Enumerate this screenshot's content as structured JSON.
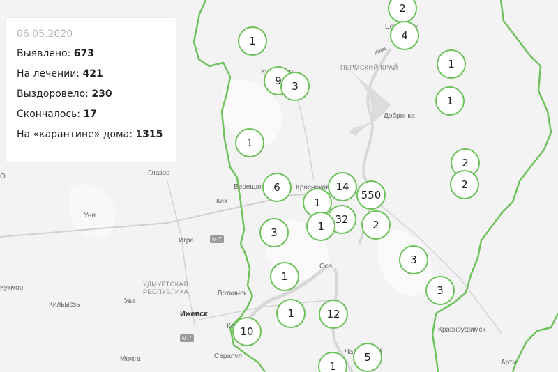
{
  "stats": {
    "date": "06.05.2020",
    "rows": [
      {
        "label": "Выявлено:",
        "value": "673"
      },
      {
        "label": "На лечении:",
        "value": "421"
      },
      {
        "label": "Выздоровело:",
        "value": "230"
      },
      {
        "label": "Скончалось:",
        "value": "17"
      },
      {
        "label": "На «карантине» дома:",
        "value": "1315"
      }
    ]
  },
  "regions": {
    "perm": "ПЕРМСКИЙ КРАЙ",
    "udmurt_line1": "УДМУРТСКАЯ",
    "udmurt_line2": "РЕСПУБЛИКА"
  },
  "places": {
    "glazov": "Глазов",
    "kez": "Кез",
    "uni": "Уни",
    "igra": "Игра",
    "votkinsk": "Воткинск",
    "izhevsk": "Ижевск",
    "kilmez": "Кильмезь",
    "uva": "Ува",
    "mozhga": "Можга",
    "sarapul": "Сарапул",
    "osa": "Оса",
    "dobryanka": "Добрянка",
    "vereshchagino": "Верещагино",
    "krasnokamsk": "Краснокамск",
    "krasnoufimsk": "Красноуфимск",
    "arti": "Арти",
    "kama": "Кама",
    "berezniki": "Березники",
    "chaykovsky": "Чайковский",
    "kudymkar": "Кудымкар",
    "kukmor": "Кукмор",
    "karakulino": "Ка",
    "bbr": "О"
  },
  "roads": {
    "m7_a": "M-7",
    "m7_b": "M-7"
  },
  "markers": [
    {
      "id": "a",
      "value": "2"
    },
    {
      "id": "b",
      "value": "4"
    },
    {
      "id": "c",
      "value": "1"
    },
    {
      "id": "d",
      "value": "9"
    },
    {
      "id": "e",
      "value": "3"
    },
    {
      "id": "f",
      "value": "1"
    },
    {
      "id": "g",
      "value": "1"
    },
    {
      "id": "h",
      "value": "1"
    },
    {
      "id": "i",
      "value": "2"
    },
    {
      "id": "j",
      "value": "2"
    },
    {
      "id": "k",
      "value": "6"
    },
    {
      "id": "l",
      "value": "14"
    },
    {
      "id": "m",
      "value": "550"
    },
    {
      "id": "n",
      "value": "1"
    },
    {
      "id": "o",
      "value": "32"
    },
    {
      "id": "p",
      "value": "1"
    },
    {
      "id": "q",
      "value": "2"
    },
    {
      "id": "r",
      "value": "3"
    },
    {
      "id": "s",
      "value": "3"
    },
    {
      "id": "t",
      "value": "1"
    },
    {
      "id": "u",
      "value": "3"
    },
    {
      "id": "v",
      "value": "1"
    },
    {
      "id": "w",
      "value": "12"
    },
    {
      "id": "x",
      "value": "10"
    },
    {
      "id": "y",
      "value": "5"
    },
    {
      "id": "z",
      "value": "1"
    }
  ],
  "colors": {
    "border": "#6dc25b",
    "water": "#dcdcdc",
    "land": "#f3f3f3"
  }
}
